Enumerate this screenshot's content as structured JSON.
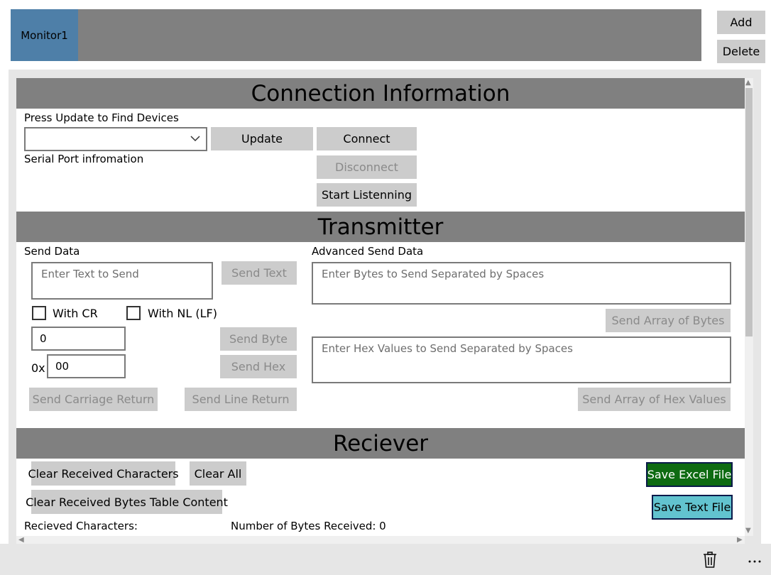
{
  "tabs": [
    {
      "label": "Monitor1"
    }
  ],
  "side": {
    "add_label": "Add",
    "delete_label": "Delete"
  },
  "connection": {
    "header": "Connection Information",
    "hint": "Press Update to Find Devices",
    "port_info": "Serial Port infromation",
    "update_label": "Update",
    "connect_label": "Connect",
    "disconnect_label": "Disconnect",
    "listen_label": "Start Listenning"
  },
  "transmitter": {
    "header": "Transmitter",
    "send_data_label": "Send Data",
    "text_placeholder": "Enter Text to Send",
    "send_text_label": "Send Text",
    "with_cr_label": "With CR",
    "with_nl_label": "With NL (LF)",
    "byte_value": "0",
    "hex_prefix": "0x",
    "hex_value": "00",
    "send_byte_label": "Send Byte",
    "send_hex_label": "Send Hex",
    "send_cr_label": "Send Carriage Return",
    "send_lr_label": "Send Line Return",
    "advanced_label": "Advanced Send Data",
    "bytes_placeholder": "Enter Bytes to Send Separated by Spaces",
    "send_array_bytes_label": "Send Array of Bytes",
    "hex_placeholder": "Enter Hex Values to Send Separated by Spaces",
    "send_array_hex_label": "Send Array of Hex Values"
  },
  "receiver": {
    "header": "Reciever",
    "clear_chars_label": "Clear Received Characters",
    "clear_all_label": "Clear All",
    "clear_table_label": "Clear Received Bytes Table Content",
    "save_excel_label": "Save Excel File",
    "save_text_label": "Save Text File",
    "received_chars_label": "Recieved Characters:",
    "bytes_received_label": "Number of Bytes Received: 0"
  },
  "colors": {
    "tab_selected": "#4e7fa8",
    "save_excel": "#0e6b12",
    "save_text": "#62c3cf",
    "header_bg": "#808080"
  },
  "appbar": {
    "delete_icon": "trash-icon",
    "more_icon": "more-icon"
  }
}
